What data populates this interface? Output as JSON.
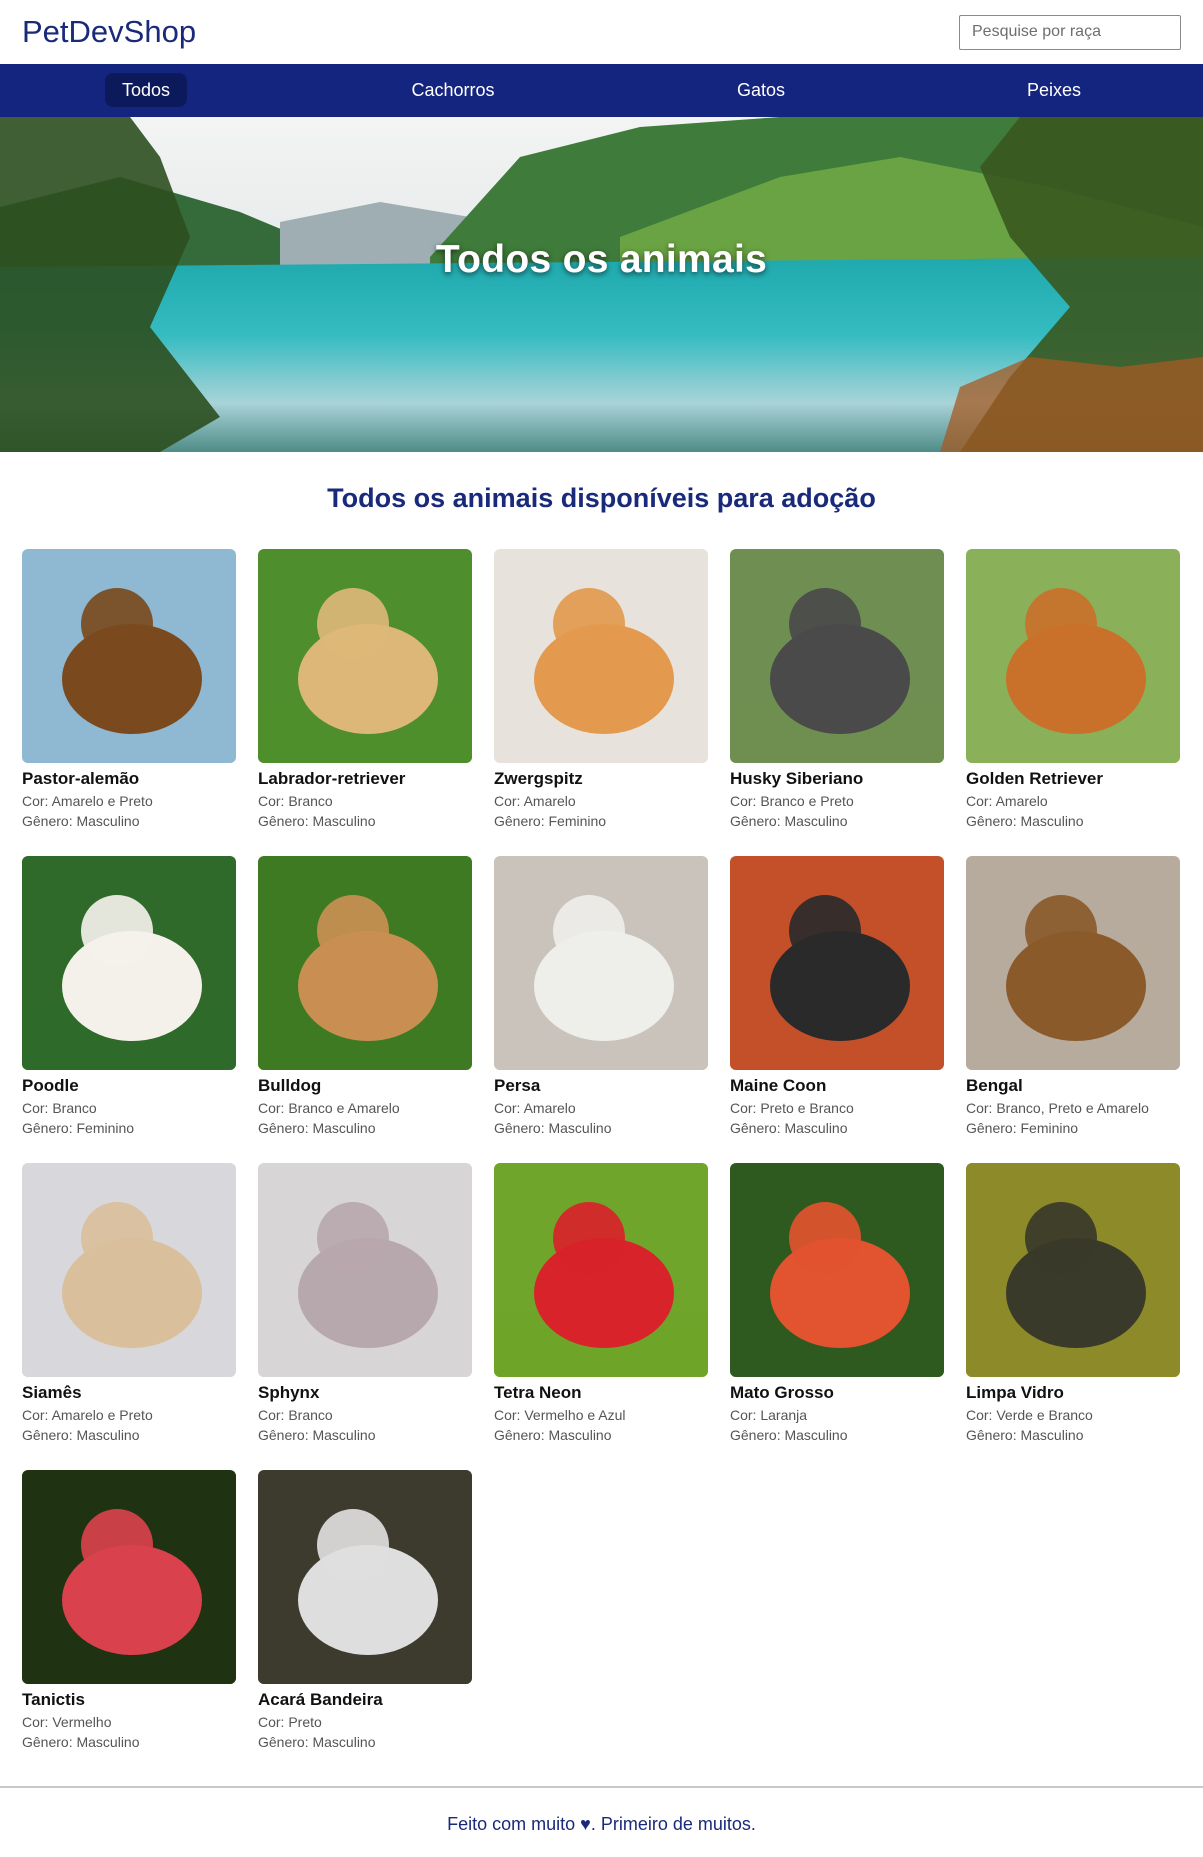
{
  "header": {
    "logo": "PetDevShop",
    "search_placeholder": "Pesquise por raça"
  },
  "nav": {
    "items": [
      {
        "label": "Todos",
        "active": true
      },
      {
        "label": "Cachorros",
        "active": false
      },
      {
        "label": "Gatos",
        "active": false
      },
      {
        "label": "Peixes",
        "active": false
      }
    ]
  },
  "hero": {
    "title": "Todos os animais"
  },
  "main": {
    "title": "Todos os animais disponíveis para adoção"
  },
  "pets": [
    {
      "name": "Pastor-alemão",
      "cor": "Cor: Amarelo e Preto",
      "genero": "Gênero: Masculino",
      "bg": "#8fb8d2",
      "fg": "#7a4a1e"
    },
    {
      "name": "Labrador-retriever",
      "cor": "Cor: Branco",
      "genero": "Gênero: Masculino",
      "bg": "#4f8e2c",
      "fg": "#dcb777"
    },
    {
      "name": "Zwergspitz",
      "cor": "Cor: Amarelo",
      "genero": "Gênero: Feminino",
      "bg": "#e7e3dc",
      "fg": "#e39a4e"
    },
    {
      "name": "Husky Siberiano",
      "cor": "Cor: Branco e Preto",
      "genero": "Gênero: Masculino",
      "bg": "#6f8f52",
      "fg": "#4a4a4a"
    },
    {
      "name": "Golden Retriever",
      "cor": "Cor: Amarelo",
      "genero": "Gênero: Masculino",
      "bg": "#8bb05a",
      "fg": "#c9712a"
    },
    {
      "name": "Poodle",
      "cor": "Cor: Branco",
      "genero": "Gênero: Feminino",
      "bg": "#2f6a2a",
      "fg": "#f4f1ea"
    },
    {
      "name": "Bulldog",
      "cor": "Cor: Branco e Amarelo",
      "genero": "Gênero: Masculino",
      "bg": "#3e7a22",
      "fg": "#c98f52"
    },
    {
      "name": "Persa",
      "cor": "Cor: Amarelo",
      "genero": "Gênero: Masculino",
      "bg": "#c9c3bb",
      "fg": "#eeeeea"
    },
    {
      "name": "Maine Coon",
      "cor": "Cor: Preto e Branco",
      "genero": "Gênero: Masculino",
      "bg": "#c4502a",
      "fg": "#2a2a2a"
    },
    {
      "name": "Bengal",
      "cor": "Cor: Branco, Preto e Amarelo",
      "genero": "Gênero: Feminino",
      "bg": "#b6ab9c",
      "fg": "#8b5a2b"
    },
    {
      "name": "Siamês",
      "cor": "Cor: Amarelo e Preto",
      "genero": "Gênero: Masculino",
      "bg": "#d8d8dc",
      "fg": "#d9bf9b"
    },
    {
      "name": "Sphynx",
      "cor": "Cor: Branco",
      "genero": "Gênero: Masculino",
      "bg": "#d7d5d6",
      "fg": "#b7a8ae"
    },
    {
      "name": "Tetra Neon",
      "cor": "Cor: Vermelho e Azul",
      "genero": "Gênero: Masculino",
      "bg": "#6ea52a",
      "fg": "#d8232a"
    },
    {
      "name": "Mato Grosso",
      "cor": "Cor: Laranja",
      "genero": "Gênero: Masculino",
      "bg": "#2e5a1f",
      "fg": "#e2532f"
    },
    {
      "name": "Limpa Vidro",
      "cor": "Cor: Verde e Branco",
      "genero": "Gênero: Masculino",
      "bg": "#8d8a2a",
      "fg": "#3a3a2a"
    },
    {
      "name": "Tanictis",
      "cor": "Cor: Vermelho",
      "genero": "Gênero: Masculino",
      "bg": "#1f3312",
      "fg": "#d9414c"
    },
    {
      "name": "Acará Bandeira",
      "cor": "Cor: Preto",
      "genero": "Gênero: Masculino",
      "bg": "#3d3a2e",
      "fg": "#dedede"
    }
  ],
  "footer": {
    "before": "Feito com muito ",
    "heart_icon": "heart-icon",
    "after": ". Primeiro de muitos."
  },
  "colors": {
    "brand": "#1a2a7a",
    "nav_bg": "#142580",
    "nav_active": "#0c1a5c"
  }
}
